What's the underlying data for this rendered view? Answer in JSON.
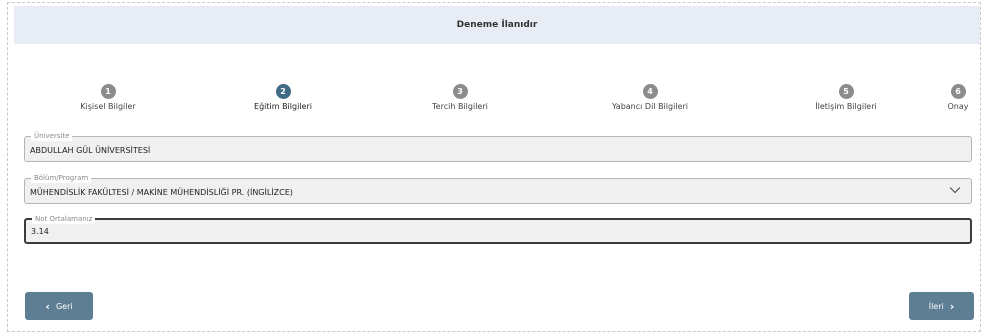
{
  "header": {
    "title": "Deneme İlanıdır"
  },
  "steps": [
    {
      "number": "1",
      "label": "Kişisel Bilgiler"
    },
    {
      "number": "2",
      "label": "Eğitim Bilgileri"
    },
    {
      "number": "3",
      "label": "Tercih Bilgileri"
    },
    {
      "number": "4",
      "label": "Yabancı Dil Bilgileri"
    },
    {
      "number": "5",
      "label": "İletişim Bilgileri"
    },
    {
      "number": "6",
      "label": "Onay"
    }
  ],
  "active_step": "2",
  "form": {
    "university": {
      "label": "Üniversite",
      "value": "ABDULLAH GÜL ÜNİVERSİTESİ"
    },
    "program": {
      "label": "Bölüm/Program",
      "value": "MÜHENDİSLİK FAKÜLTESİ / MAKİNE MÜHENDİSLİĞİ PR. (İNGİLİZCE)"
    },
    "gpa": {
      "label": "Not Ortalamanız",
      "value": "3.14"
    }
  },
  "nav": {
    "back_label": "Geri",
    "next_label": "İleri"
  },
  "colors": {
    "header_bg": "#e8edf5",
    "step_inactive": "#8c8c8c",
    "step_active": "#3f6b87",
    "button_bg": "#5d7e93"
  },
  "icons": {
    "back": "chevron-left-icon",
    "next": "chevron-right-icon",
    "dropdown": "chevron-down-icon"
  }
}
